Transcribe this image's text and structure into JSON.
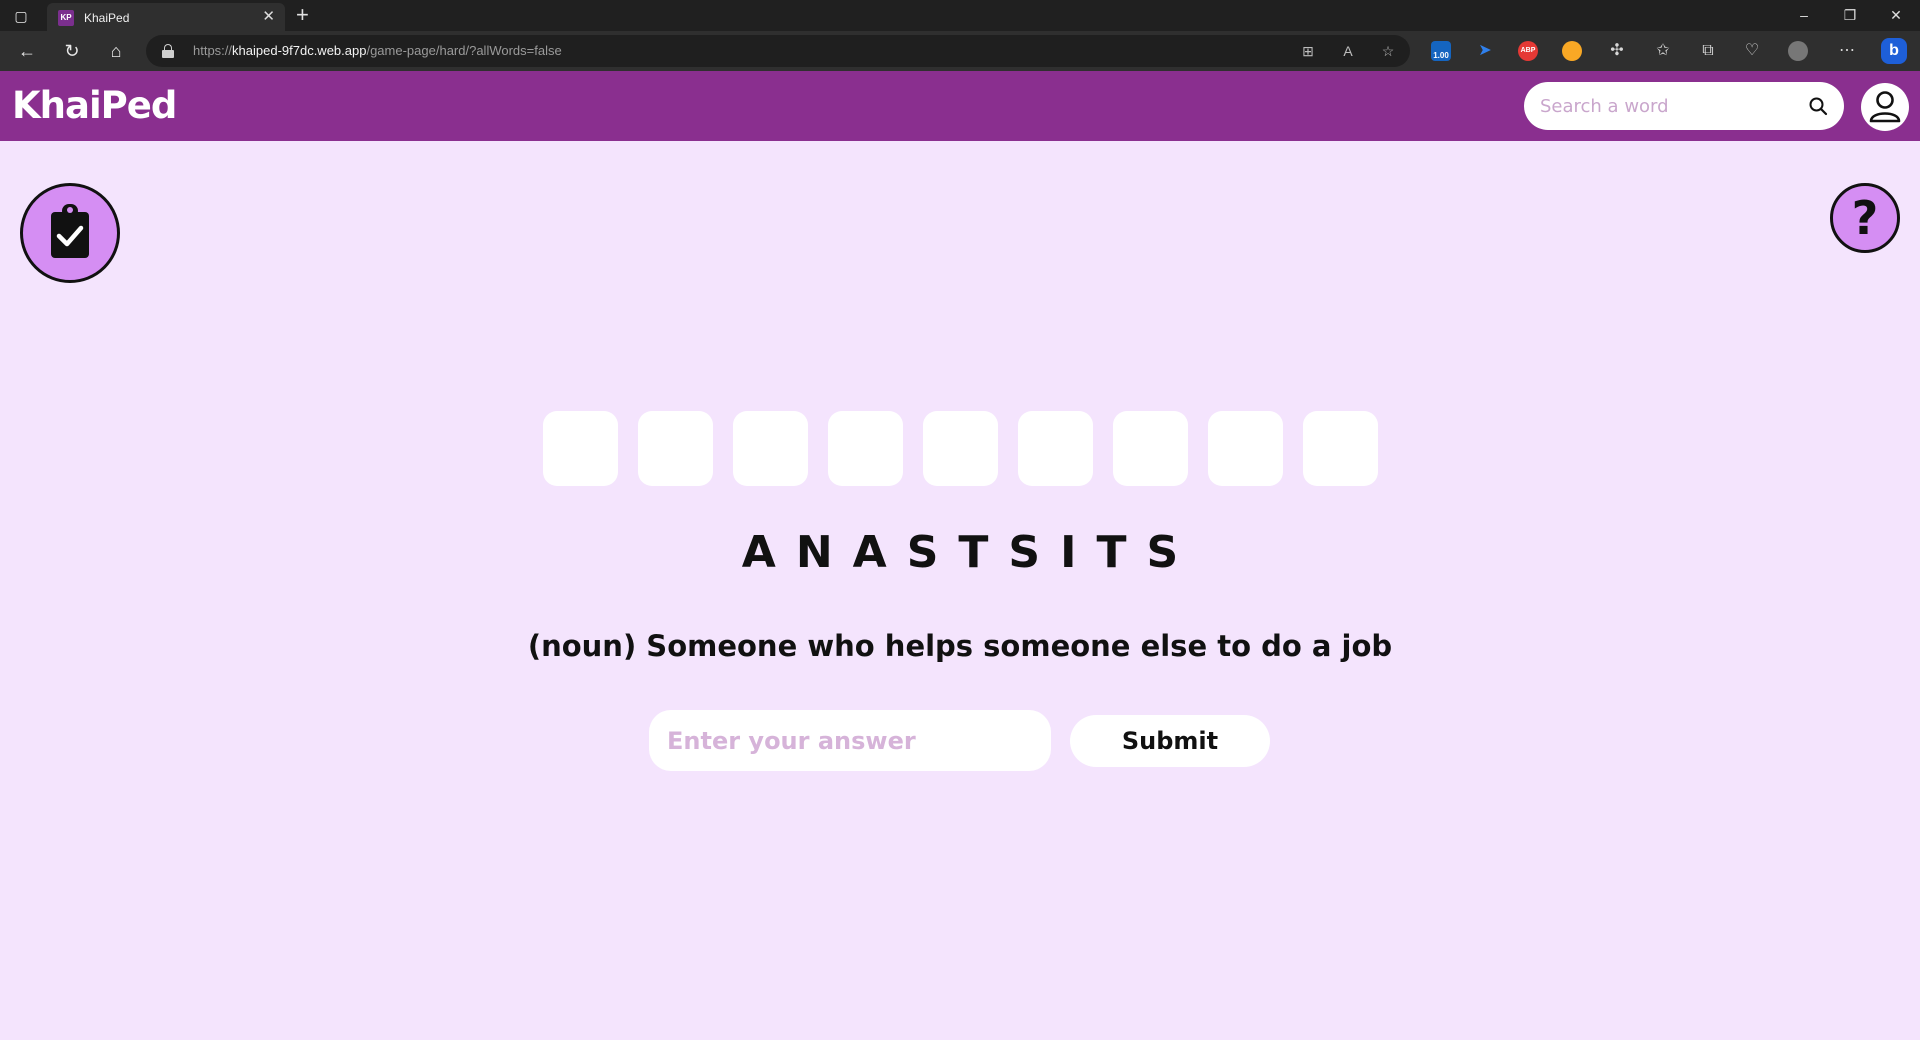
{
  "browser": {
    "tab_title": "KhaiPed",
    "tab_favicon_text": "KP",
    "url_prefix": "https://",
    "url_host": "khaiped-9f7dc.web.app",
    "url_path": "/game-page/hard/?allWords=false",
    "extension_badge": "1.00",
    "abp_label": "ABP"
  },
  "header": {
    "brand": "KhaiPed",
    "search_placeholder": "Search a word"
  },
  "game": {
    "slot_count": 9,
    "scrambled_word": "ANASTSITS",
    "definition": "(noun) Someone who helps someone else to do a job",
    "answer_placeholder": "Enter your answer",
    "submit_label": "Submit"
  },
  "colors": {
    "header_bg": "#8a2f8f",
    "page_bg": "#f4e4fd",
    "round_button_bg": "#d58ef3"
  }
}
